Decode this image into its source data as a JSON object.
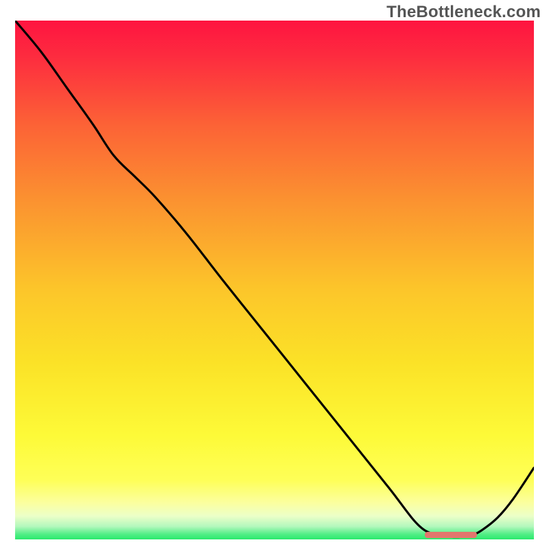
{
  "watermark": "TheBottleneck.com",
  "colors": {
    "gradient_top": "#fe1440",
    "gradient_upper_mid": "#fb9330",
    "gradient_mid": "#fbe227",
    "gradient_lower_mid": "#feff57",
    "gradient_pale": "#f6ffc3",
    "gradient_bottom": "#2bea6c",
    "curve": "#000000",
    "marker": "#e2766d",
    "watermark_text": "#555555"
  },
  "chart_data": {
    "type": "line",
    "title": "",
    "xlabel": "",
    "ylabel": "",
    "xlim": [
      0,
      100
    ],
    "ylim": [
      0,
      100
    ],
    "x": [
      0,
      5,
      10,
      15,
      19,
      23,
      27,
      33,
      40,
      48,
      56,
      64,
      72,
      78,
      82,
      84,
      86,
      88,
      90,
      93,
      96,
      100
    ],
    "values": [
      100,
      94,
      87,
      80,
      74,
      70,
      66,
      59,
      50,
      40,
      30,
      20,
      10,
      2.5,
      0.8,
      0.5,
      0.5,
      0.8,
      1.8,
      4.2,
      7.8,
      13.8
    ],
    "marker": {
      "x_start": 79,
      "x_end": 89,
      "y": 0.9
    },
    "note": "Values are read as percentage of full height (100 = top of gradient, 0 = bottom green band). X is percentage of width."
  }
}
